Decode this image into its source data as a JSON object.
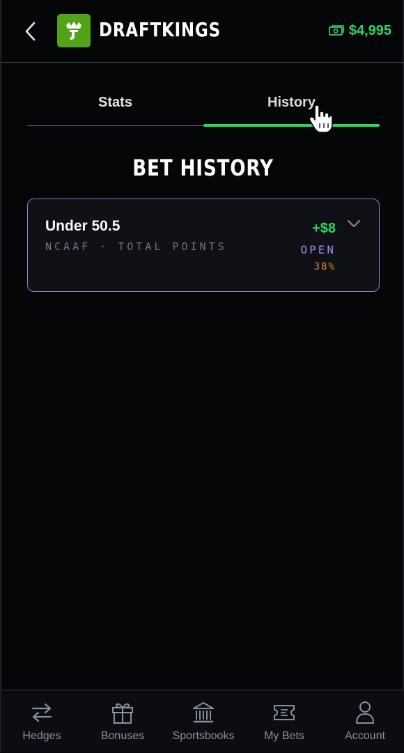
{
  "header": {
    "brand_name": "DRAFTKINGS",
    "balance": "$4,995"
  },
  "tabs": [
    {
      "label": "Stats",
      "active": false
    },
    {
      "label": "History",
      "active": true
    }
  ],
  "section_title": "BET HISTORY",
  "bets": [
    {
      "title": "Under 50.5",
      "meta": "NCAAF · TOTAL POINTS",
      "payout": "+$8",
      "status": "OPEN",
      "percent": "38%"
    }
  ],
  "bottom_nav": [
    {
      "label": "Hedges",
      "icon": "arrows-swap-icon"
    },
    {
      "label": "Bonuses",
      "icon": "gift-icon"
    },
    {
      "label": "Sportsbooks",
      "icon": "bank-icon"
    },
    {
      "label": "My Bets",
      "icon": "ticket-icon"
    },
    {
      "label": "Account",
      "icon": "user-icon"
    }
  ],
  "colors": {
    "accent_green": "#2fd466",
    "logo_green": "#53a318",
    "status_purple": "#9d87f0",
    "card_border": "#8a7fd6",
    "percent_orange": "#e08a2e"
  }
}
